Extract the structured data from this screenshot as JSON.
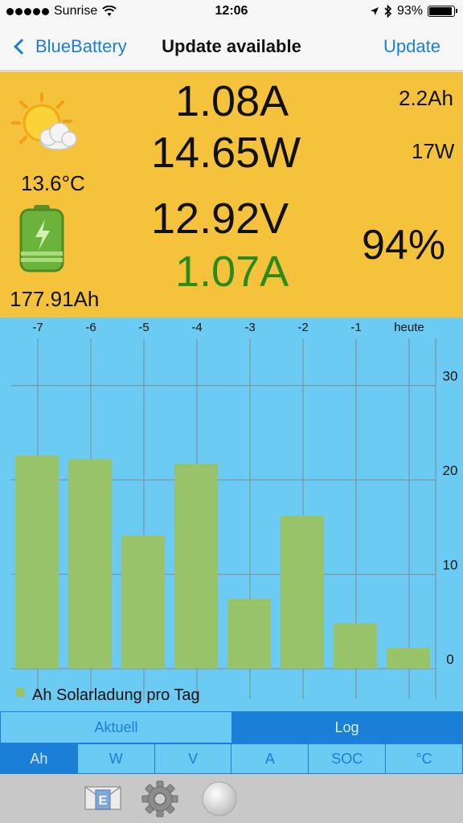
{
  "status_bar": {
    "carrier": "Sunrise",
    "time": "12:06",
    "battery_percent": "93%",
    "battery_level": 0.93,
    "icons": [
      "signal-dots-icon",
      "wifi-icon",
      "location-arrow-icon",
      "bluetooth-icon",
      "battery-icon"
    ]
  },
  "nav": {
    "back_label": "BlueBattery",
    "title": "Update available",
    "action_label": "Update"
  },
  "readings": {
    "current_a": "1.08A",
    "power_w": "14.65W",
    "voltage_v": "12.92V",
    "charge_current": "1.07A",
    "ah_small": "2.2Ah",
    "w_small": "17W",
    "temperature": "13.6°C",
    "capacity": "177.91Ah",
    "soc": "94%"
  },
  "colors": {
    "panel": "#f5c23c",
    "chart_bg": "#6ccbf2",
    "bar": "#99c368",
    "accent": "#1a7fd6",
    "charge_green": "#2a8a1e"
  },
  "chart_data": {
    "type": "bar",
    "categories": [
      "-7",
      "-6",
      "-5",
      "-4",
      "-3",
      "-2",
      "-1",
      "heute"
    ],
    "series": [
      {
        "name": "Ah Solarladung pro Tag",
        "values": [
          22.6,
          22.2,
          14.1,
          21.7,
          7.4,
          16.2,
          4.8,
          2.2
        ]
      }
    ],
    "ylim": [
      0,
      35
    ],
    "yticks": [
      0,
      10,
      20,
      30
    ],
    "grid": true,
    "legend_position": "bottom-left",
    "x_axis_position": "top",
    "y_axis_position": "right"
  },
  "segment_mode": {
    "options": [
      "Aktuell",
      "Log"
    ],
    "selected": "Log"
  },
  "segment_unit": {
    "options": [
      "Ah",
      "W",
      "V",
      "A",
      "SOC",
      "°C"
    ],
    "selected": "Ah"
  },
  "toolbar": {
    "icons": [
      "email-icon",
      "settings-gear-icon",
      "round-button-icon"
    ],
    "email_letter": "E"
  }
}
